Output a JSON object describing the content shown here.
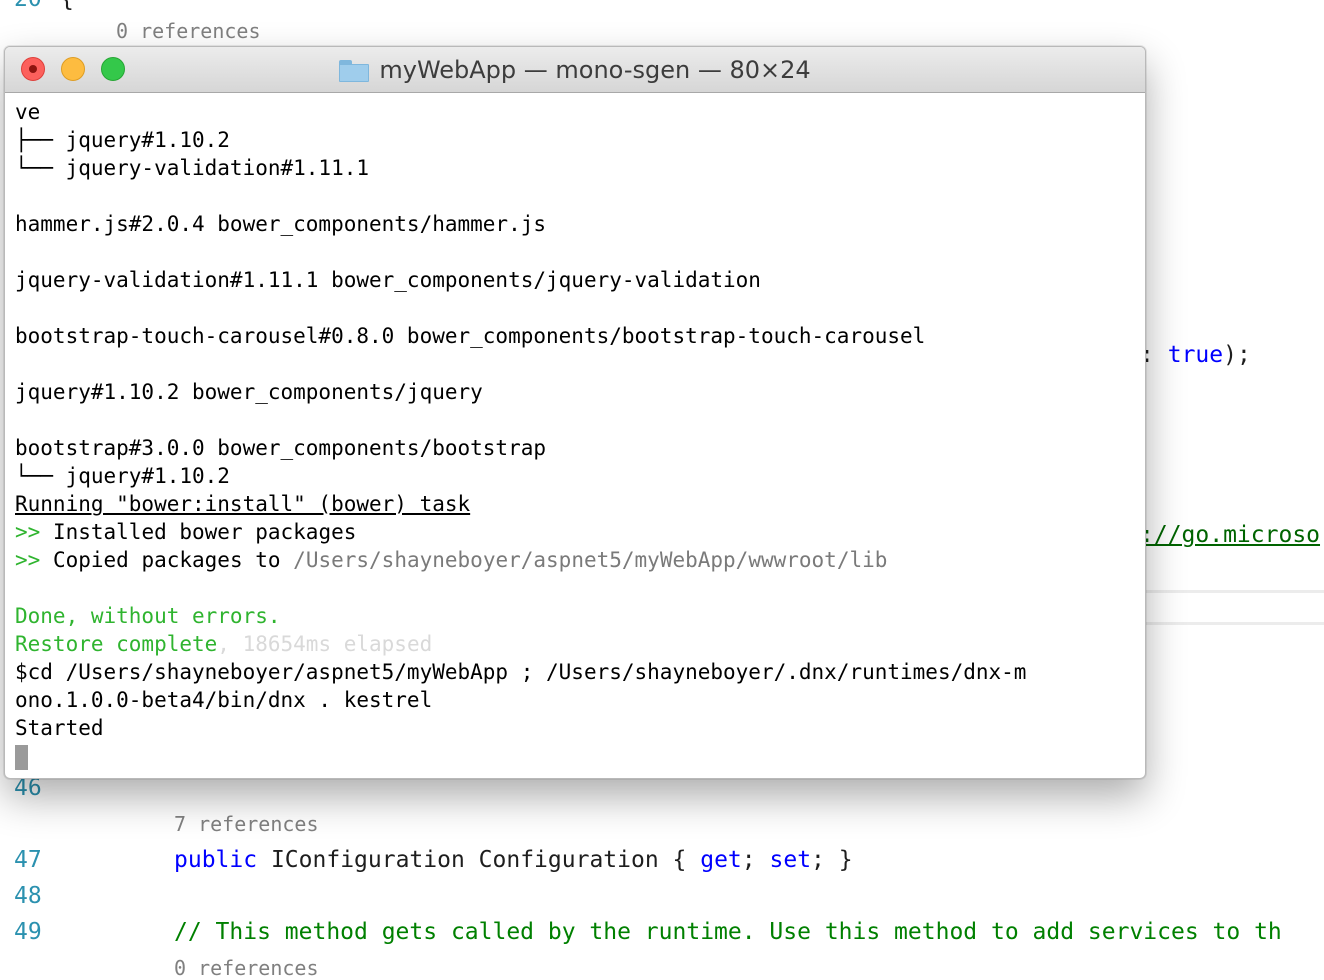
{
  "editor": {
    "top_refs": "0 references",
    "line_20_partial": "20",
    "line_20_brace": "{",
    "right_fragment_1_colon": ":",
    "right_fragment_1_kw": "true",
    "right_fragment_1_tail": ");",
    "right_fragment_2_link": "://go.microso",
    "line_46": "46",
    "refs_7": "7 references",
    "line_47": "47",
    "line_47_kw1": "public",
    "line_47_mid": "IConfiguration Configuration {",
    "line_47_get": "get",
    "line_47_semi": ";",
    "line_47_set": "set",
    "line_47_end": "; }",
    "line_48": "48",
    "line_49": "49",
    "line_49_comment": "// This method gets called by the runtime. Use this method to add services to th",
    "refs_0_bottom": "0 references"
  },
  "terminal": {
    "title": "myWebApp — mono-sgen — 80×24",
    "lines": [
      "ve",
      "├── jquery#1.10.2",
      "└── jquery-validation#1.11.1",
      "",
      "hammer.js#2.0.4 bower_components/hammer.js",
      "",
      "jquery-validation#1.11.1 bower_components/jquery-validation",
      "",
      "bootstrap-touch-carousel#0.8.0 bower_components/bootstrap-touch-carousel",
      "",
      "jquery#1.10.2 bower_components/jquery",
      "",
      "bootstrap#3.0.0 bower_components/bootstrap",
      "└── jquery#1.10.2"
    ],
    "running_task": "Running \"bower:install\" (bower) task",
    "prompt_marker": ">>",
    "installed": " Installed bower packages",
    "copied_prefix": " Copied packages to ",
    "copied_path": "/Users/shayneboyer/aspnet5/myWebApp/wwwroot/lib",
    "done": "Done, without errors.",
    "restore": "Restore complete",
    "restore_elapsed": ", 18654ms elapsed",
    "cmd_line_1": "$cd /Users/shayneboyer/aspnet5/myWebApp ; /Users/shayneboyer/.dnx/runtimes/dnx-m",
    "cmd_line_2": "ono.1.0.0-beta4/bin/dnx . kestrel",
    "started": "Started"
  },
  "colors": {
    "success_green": "#2fb42f",
    "path_gray": "#7a7a7a",
    "line_number_blue": "#2b91af",
    "keyword_blue": "#0000ff",
    "comment_green": "#008000",
    "close_red": "#fc605c",
    "minimize_yellow": "#fdbc40",
    "zoom_green": "#34c84a"
  },
  "icons": {
    "title_icon": "folder-icon",
    "close": "close-icon",
    "minimize": "minimize-icon",
    "zoom": "zoom-icon",
    "cursor": "terminal-cursor"
  }
}
